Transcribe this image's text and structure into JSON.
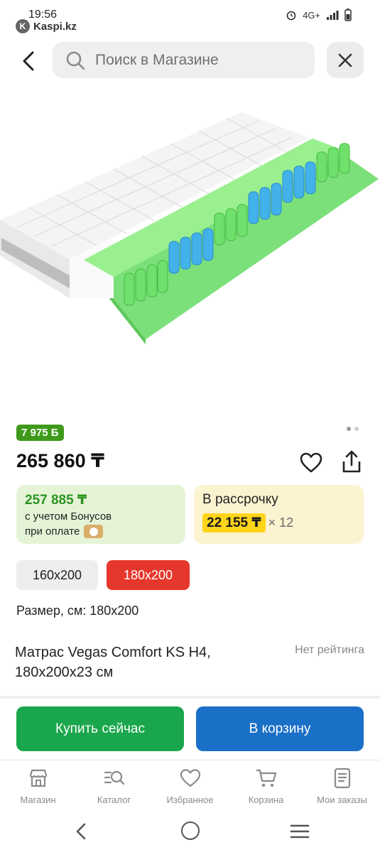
{
  "status": {
    "time": "19:56",
    "app_name": "Kaspi.kz",
    "network": "4G+"
  },
  "search": {
    "placeholder": "Поиск в Магазине"
  },
  "product": {
    "bonus_badge": "7 975 Б",
    "price": "265 860 ₸",
    "bonus_price": {
      "value": "257 885 ₸",
      "line1": "с учетом Бонусов",
      "line2": "при оплате"
    },
    "installment": {
      "title": "В рассрочку",
      "amount": "22 155 ₸",
      "multiplier": "× 12"
    },
    "sizes": [
      "160x200",
      "180x200"
    ],
    "selected_size": "180x200",
    "size_label": "Размер, см: 180x200",
    "title": "Матрас Vegas Comfort KS H4, 180x200x23 см",
    "rating": "Нет рейтинга"
  },
  "actions": {
    "buy_now": "Купить сейчас",
    "add_to_cart": "В корзину"
  },
  "tabs": [
    {
      "label": "Магазин",
      "icon": "shop-icon"
    },
    {
      "label": "Каталог",
      "icon": "catalog-icon"
    },
    {
      "label": "Избранное",
      "icon": "heart-icon"
    },
    {
      "label": "Корзина",
      "icon": "cart-icon"
    },
    {
      "label": "Мои заказы",
      "icon": "orders-icon"
    }
  ],
  "colors": {
    "bonus_green": "#3f9a1b",
    "selected_chip": "#e6372c",
    "buy_button": "#1aa64c",
    "cart_button": "#1a6fc7",
    "installment_highlight": "#ffd51a"
  }
}
